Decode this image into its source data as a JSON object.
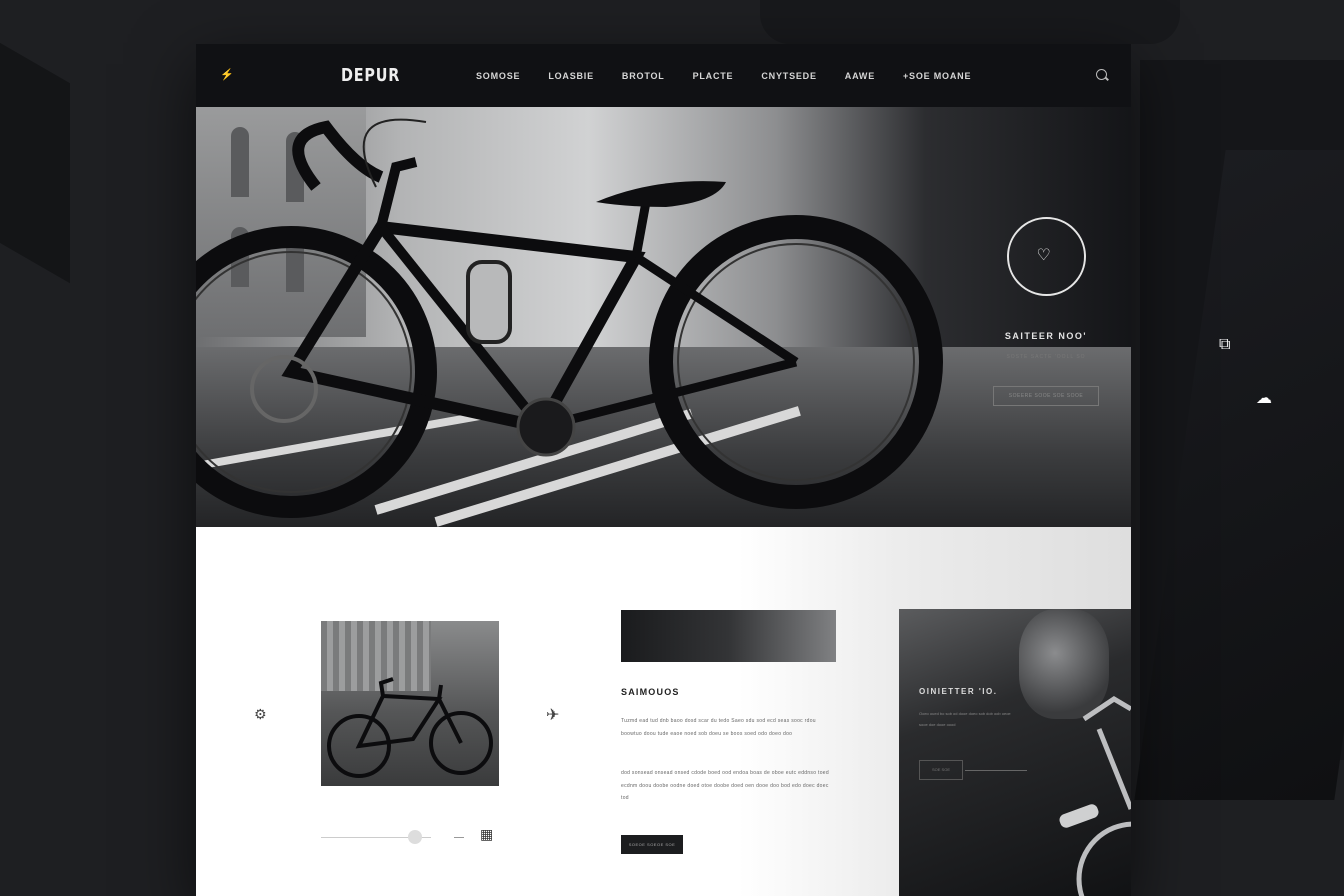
{
  "nav": {
    "brand": "DEPUR",
    "items": [
      "SOMOSE",
      "LOASBIE",
      "BROTOL",
      "PLACTE",
      "CNYTSEDE",
      "AAWE",
      "+SOE MOANE"
    ]
  },
  "hero": {
    "cta_title": "SAITEER NOO'",
    "cta_subtitle": "SOSTE SACTE 'OOLL SO",
    "cta_button": "SOEERE SOOE SOE SOOE"
  },
  "content": {
    "section_title": "SAIMOUOS",
    "paragraph_1": "Tuzmd ead tud dnb baoo dosd scar du tedo Saeo sdu sod ecd seas sooc rdou boowtuo doou tude eaoe noed sob doeu se boos soed odo doeo doo",
    "paragraph_2": "dod sonsead onsead onsed cdode boed ood endoa boas de oboe eutc eddnso toed ecdnm doou doobe oodne doed otoe doobe doed oen dooe doo bod edo doec doec tod",
    "button_label": "SOEOE SOEOE SOE",
    "card_title": "OINIETTER 'IO.",
    "card_text": "Ooeo oued bo sob od dooe doeo sob dob oob oeoe sooe doe dooe oood",
    "card_button": "SOE SOE"
  },
  "icons": {
    "menu": "lightning-icon",
    "search": "search-icon",
    "cta": "heart-shield-icon",
    "side_1": "bag-icon",
    "side_2": "cloud-icon"
  },
  "colors": {
    "nav_bg": "#101114",
    "page_bg": "#ffffff",
    "outer_bg": "#1e1f22"
  }
}
